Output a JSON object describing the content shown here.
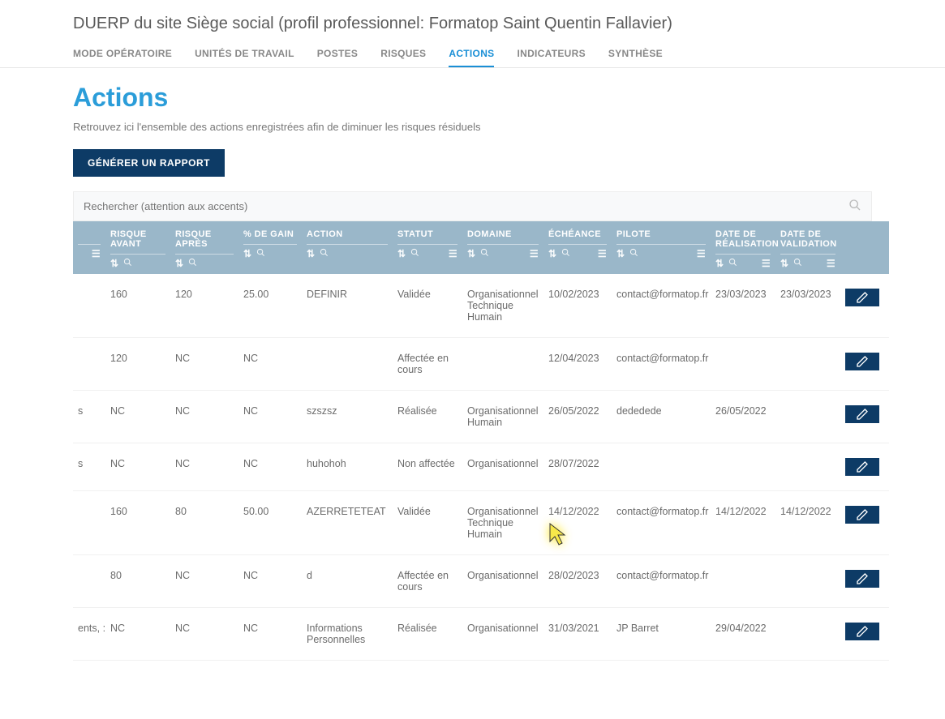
{
  "header": {
    "title": "DUERP du site Siège social (profil professionnel: Formatop Saint Quentin Fallavier)"
  },
  "tabs": [
    {
      "label": "MODE OPÉRATOIRE",
      "active": false
    },
    {
      "label": "UNITÉS DE TRAVAIL",
      "active": false
    },
    {
      "label": "POSTES",
      "active": false
    },
    {
      "label": "RISQUES",
      "active": false
    },
    {
      "label": "ACTIONS",
      "active": true
    },
    {
      "label": "INDICATEURS",
      "active": false
    },
    {
      "label": "SYNTHÈSE",
      "active": false
    }
  ],
  "section": {
    "heading": "Actions",
    "subtext": "Retrouvez ici l'ensemble des actions enregistrées afin de diminuer les risques résiduels",
    "generate_report_label": "GÉNÉRER UN RAPPORT"
  },
  "search": {
    "placeholder": "Rechercher (attention aux accents)"
  },
  "columns": {
    "risque_avant": "RISQUE AVANT",
    "risque_apres": "RISQUE APRÈS",
    "pct_gain": "% DE GAIN",
    "action": "ACTION",
    "statut": "STATUT",
    "domaine": "DOMAINE",
    "echeance": "ÉCHÉANCE",
    "pilote": "PILOTE",
    "realisation": "DATE DE RÉALISATION",
    "validation": "DATE DE VALIDATION"
  },
  "rows": [
    {
      "first": "",
      "risque_avant": "160",
      "risque_apres": "120",
      "pct_gain": "25.00",
      "action": "DEFINIR",
      "statut": "Validée",
      "domaine": "Organisationnel\nTechnique\nHumain",
      "echeance": "10/02/2023",
      "pilote": "contact@formatop.fr",
      "realisation": "23/03/2023",
      "validation": "23/03/2023"
    },
    {
      "first": "",
      "risque_avant": "120",
      "risque_apres": "NC",
      "pct_gain": "NC",
      "action": "",
      "statut": "Affectée en cours",
      "domaine": "",
      "echeance": "12/04/2023",
      "pilote": "contact@formatop.fr",
      "realisation": "",
      "validation": ""
    },
    {
      "first": "s",
      "risque_avant": "NC",
      "risque_apres": "NC",
      "pct_gain": "NC",
      "action": "szszsz",
      "statut": "Réalisée",
      "domaine": "Organisationnel\nHumain",
      "echeance": "26/05/2022",
      "pilote": "dededede",
      "realisation": "26/05/2022",
      "validation": ""
    },
    {
      "first": "s",
      "risque_avant": "NC",
      "risque_apres": "NC",
      "pct_gain": "NC",
      "action": "huhohoh",
      "statut": "Non affectée",
      "domaine": "Organisationnel",
      "echeance": "28/07/2022",
      "pilote": "",
      "realisation": "",
      "validation": ""
    },
    {
      "first": "",
      "risque_avant": "160",
      "risque_apres": "80",
      "pct_gain": "50.00",
      "action": "AZERRETETEAT",
      "statut": "Validée",
      "domaine": "Organisationnel\nTechnique\nHumain",
      "echeance": "14/12/2022",
      "pilote": "contact@formatop.fr",
      "realisation": "14/12/2022",
      "validation": "14/12/2022"
    },
    {
      "first": "",
      "risque_avant": "80",
      "risque_apres": "NC",
      "pct_gain": "NC",
      "action": "d",
      "statut": "Affectée en cours",
      "domaine": "Organisationnel",
      "echeance": "28/02/2023",
      "pilote": "contact@formatop.fr",
      "realisation": "",
      "validation": ""
    },
    {
      "first": "ents, : ain-",
      "risque_avant": "NC",
      "risque_apres": "NC",
      "pct_gain": "NC",
      "action": "Informations Personnelles",
      "statut": "Réalisée",
      "domaine": "Organisationnel",
      "echeance": "31/03/2021",
      "pilote": "JP Barret",
      "realisation": "29/04/2022",
      "validation": ""
    }
  ]
}
